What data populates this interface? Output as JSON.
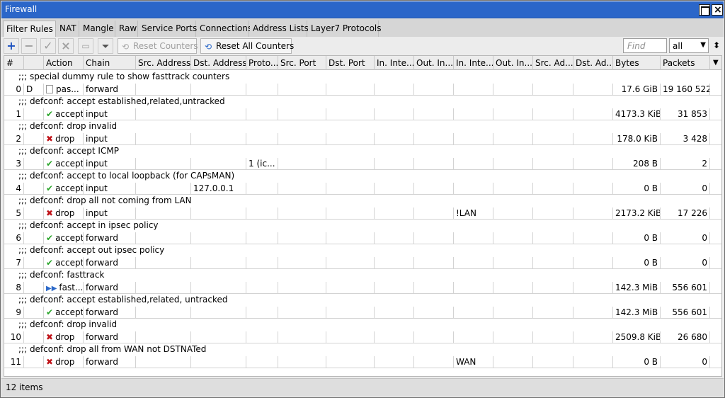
{
  "window": {
    "title": "Firewall"
  },
  "tabs": [
    "Filter Rules",
    "NAT",
    "Mangle",
    "Raw",
    "Service Ports",
    "Connections",
    "Address Lists",
    "Layer7 Protocols"
  ],
  "toolbar": {
    "reset_counters": "Reset Counters",
    "reset_all_counters": "Reset All Counters",
    "find_placeholder": "Find",
    "filter_value": "all"
  },
  "columns": [
    "#",
    "",
    "Action",
    "Chain",
    "Src. Address",
    "Dst. Address",
    "Proto...",
    "Src. Port",
    "Dst. Port",
    "In. Inte...",
    "Out. In...",
    "In. Inte...",
    "Out. In...",
    "Src. Ad...",
    "Dst. Ad...",
    "Bytes",
    "Packets"
  ],
  "rows": [
    {
      "comment": ";;; special dummy rule to show fasttrack counters",
      "num": "0",
      "flag": "D",
      "action_icon": "pass-icon",
      "action": "pas...",
      "chain": "forward",
      "src": "",
      "dst": "",
      "proto": "",
      "in_iface": "",
      "bytes": "17.6 GiB",
      "packets": "19 160 522"
    },
    {
      "comment": ";;; defconf: accept established,related,untracked",
      "num": "1",
      "flag": "",
      "action_icon": "accept-icon",
      "action": "accept",
      "chain": "input",
      "src": "",
      "dst": "",
      "proto": "",
      "in_iface": "",
      "bytes": "4173.3 KiB",
      "packets": "31 853"
    },
    {
      "comment": ";;; defconf: drop invalid",
      "num": "2",
      "flag": "",
      "action_icon": "drop-icon",
      "action": "drop",
      "chain": "input",
      "src": "",
      "dst": "",
      "proto": "",
      "in_iface": "",
      "bytes": "178.0 KiB",
      "packets": "3 428"
    },
    {
      "comment": ";;; defconf: accept ICMP",
      "num": "3",
      "flag": "",
      "action_icon": "accept-icon",
      "action": "accept",
      "chain": "input",
      "src": "",
      "dst": "",
      "proto": "1 (ic...",
      "in_iface": "",
      "bytes": "208 B",
      "packets": "2"
    },
    {
      "comment": ";;; defconf: accept to local loopback (for CAPsMAN)",
      "num": "4",
      "flag": "",
      "action_icon": "accept-icon",
      "action": "accept",
      "chain": "input",
      "src": "",
      "dst": "127.0.0.1",
      "proto": "",
      "in_iface": "",
      "bytes": "0 B",
      "packets": "0"
    },
    {
      "comment": ";;; defconf: drop all not coming from LAN",
      "num": "5",
      "flag": "",
      "action_icon": "drop-icon",
      "action": "drop",
      "chain": "input",
      "src": "",
      "dst": "",
      "proto": "",
      "in_iface": "!LAN",
      "bytes": "2173.2 KiB",
      "packets": "17 226"
    },
    {
      "comment": ";;; defconf: accept in ipsec policy",
      "num": "6",
      "flag": "",
      "action_icon": "accept-icon",
      "action": "accept",
      "chain": "forward",
      "src": "",
      "dst": "",
      "proto": "",
      "in_iface": "",
      "bytes": "0 B",
      "packets": "0"
    },
    {
      "comment": ";;; defconf: accept out ipsec policy",
      "num": "7",
      "flag": "",
      "action_icon": "accept-icon",
      "action": "accept",
      "chain": "forward",
      "src": "",
      "dst": "",
      "proto": "",
      "in_iface": "",
      "bytes": "0 B",
      "packets": "0"
    },
    {
      "comment": ";;; defconf: fasttrack",
      "num": "8",
      "flag": "",
      "action_icon": "fasttrack-icon",
      "action": "fast...",
      "chain": "forward",
      "src": "",
      "dst": "",
      "proto": "",
      "in_iface": "",
      "bytes": "142.3 MiB",
      "packets": "556 601"
    },
    {
      "comment": ";;; defconf: accept established,related, untracked",
      "num": "9",
      "flag": "",
      "action_icon": "accept-icon",
      "action": "accept",
      "chain": "forward",
      "src": "",
      "dst": "",
      "proto": "",
      "in_iface": "",
      "bytes": "142.3 MiB",
      "packets": "556 601"
    },
    {
      "comment": ";;; defconf: drop invalid",
      "num": "10",
      "flag": "",
      "action_icon": "drop-icon",
      "action": "drop",
      "chain": "forward",
      "src": "",
      "dst": "",
      "proto": "",
      "in_iface": "",
      "bytes": "2509.8 KiB",
      "packets": "26 680"
    },
    {
      "comment": ";;; defconf: drop all from WAN not DSTNATed",
      "num": "11",
      "flag": "",
      "action_icon": "drop-icon",
      "action": "drop",
      "chain": "forward",
      "src": "",
      "dst": "",
      "proto": "",
      "in_iface": "WAN",
      "bytes": "0 B",
      "packets": "0"
    }
  ],
  "status": {
    "text": "12 items"
  },
  "colors": {
    "titlebar": "#2b66c9",
    "accept": "#2aa52a",
    "drop": "#c0141a",
    "fasttrack": "#2c69c9"
  }
}
